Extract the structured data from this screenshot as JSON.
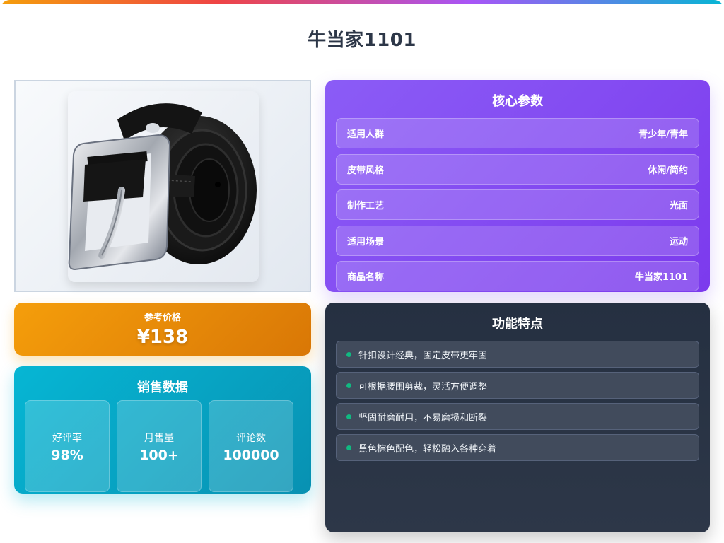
{
  "page": {
    "title": "牛当家1101"
  },
  "product_image": {
    "subject": "black-leather-belt-with-silver-buckle"
  },
  "core_params": {
    "title": "核心参数",
    "rows": [
      {
        "label": "适用人群",
        "value": "青少年/青年"
      },
      {
        "label": "皮带风格",
        "value": "休闲/简约"
      },
      {
        "label": "制作工艺",
        "value": "光面"
      },
      {
        "label": "适用场景",
        "value": "运动"
      },
      {
        "label": "商品名称",
        "value": "牛当家1101"
      }
    ]
  },
  "price": {
    "label": "参考价格",
    "value": "¥138"
  },
  "sales": {
    "title": "销售数据",
    "stats": [
      {
        "label": "好评率",
        "value": "98%"
      },
      {
        "label": "月售量",
        "value": "100+"
      },
      {
        "label": "评论数",
        "value": "100000"
      }
    ]
  },
  "features": {
    "title": "功能特点",
    "items": [
      "针扣设计经典，固定皮带更牢固",
      "可根据腰围剪裁，灵活方便调整",
      "坚固耐磨耐用，不易磨损和断裂",
      "黑色棕色配色，轻松融入各种穿着"
    ]
  },
  "colors": {
    "core_panel": "#8b5cf6",
    "price_panel": "#f59e0b",
    "sales_panel": "#06b6d4",
    "features_panel": "#2d3748",
    "feature_dot": "#10b981"
  }
}
